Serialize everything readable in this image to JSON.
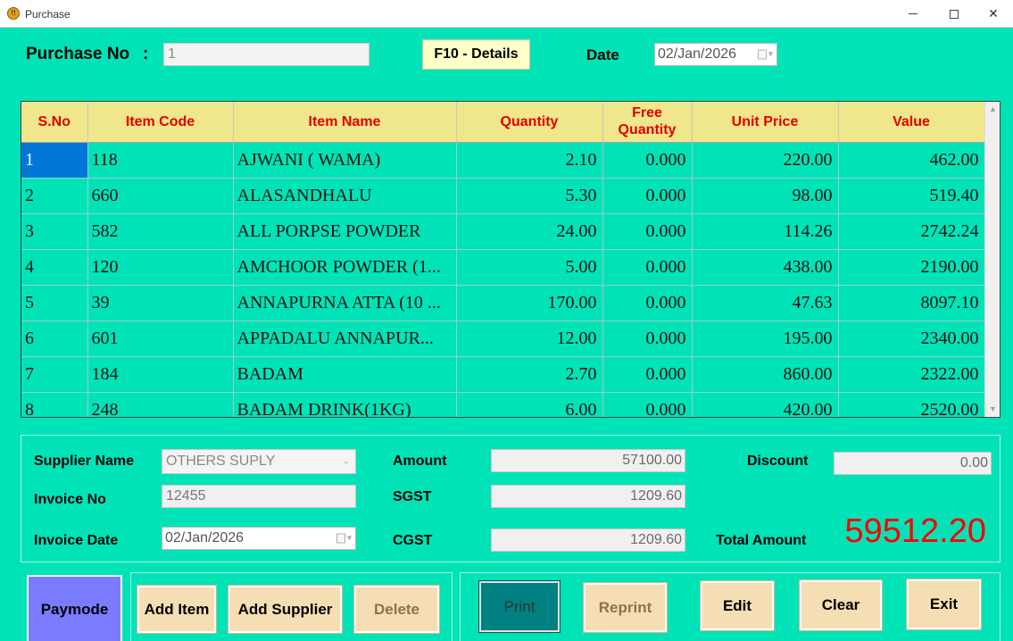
{
  "window": {
    "title": "Purchase"
  },
  "header": {
    "purchase_no_label": "Purchase No",
    "colon": ":",
    "purchase_no_value": "1",
    "details_button": "F10 - Details",
    "date_label": "Date",
    "date_value": "02/Jan/2026"
  },
  "grid": {
    "columns": [
      "S.No",
      "Item Code",
      "Item Name",
      "Quantity",
      "Free Quantity",
      "Unit Price",
      "Value"
    ],
    "rows": [
      [
        "1",
        "118",
        "AJWANI ( WAMA)",
        "2.10",
        "0.000",
        "220.00",
        "462.00"
      ],
      [
        "2",
        "660",
        "ALASANDHALU",
        "5.30",
        "0.000",
        "98.00",
        "519.40"
      ],
      [
        "3",
        "582",
        "ALL PORPSE POWDER",
        "24.00",
        "0.000",
        "114.26",
        "2742.24"
      ],
      [
        "4",
        "120",
        "AMCHOOR POWDER (1...",
        "5.00",
        "0.000",
        "438.00",
        "2190.00"
      ],
      [
        "5",
        "39",
        "ANNAPURNA ATTA (10 ...",
        "170.00",
        "0.000",
        "47.63",
        "8097.10"
      ],
      [
        "6",
        "601",
        "APPADALU ANNAPUR...",
        "12.00",
        "0.000",
        "195.00",
        "2340.00"
      ],
      [
        "7",
        "184",
        "BADAM",
        "2.70",
        "0.000",
        "860.00",
        "2322.00"
      ],
      [
        "8",
        "248",
        "BADAM DRINK(1KG)",
        "6.00",
        "0.000",
        "420.00",
        "2520.00"
      ]
    ]
  },
  "summary": {
    "supplier_name_label": "Supplier Name",
    "supplier_name_value": "OTHERS SUPLY",
    "invoice_no_label": "Invoice No",
    "invoice_no_value": "12455",
    "invoice_date_label": "Invoice Date",
    "invoice_date_value": "02/Jan/2026",
    "amount_label": "Amount",
    "amount_value": "57100.00",
    "sgst_label": "SGST",
    "sgst_value": "1209.60",
    "cgst_label": "CGST",
    "cgst_value": "1209.60",
    "discount_label": "Discount",
    "discount_value": "0.00",
    "total_amount_label": "Total Amount",
    "total_amount_value": "59512.20"
  },
  "buttons": {
    "paymode": "Paymode",
    "add_item": "Add Item",
    "add_supplier": "Add Supplier",
    "delete": "Delete",
    "print": "Print",
    "reprint": "Reprint",
    "edit": "Edit",
    "clear": "Clear",
    "exit": "Exit"
  },
  "colors": {
    "background": "#00e3b7",
    "grid_header": "#f0e68c",
    "header_text": "#e00000",
    "total_amount": "#ff0000",
    "selected_cell": "#0078d7",
    "button": "#f5deb3",
    "paymode_button": "#7b7bff",
    "print_button": "#008080"
  },
  "icons": [
    "app-icon",
    "minimize-icon",
    "maximize-icon",
    "close-icon",
    "calendar-icon",
    "chevron-down-icon",
    "scroll-up-icon",
    "scroll-down-icon"
  ]
}
